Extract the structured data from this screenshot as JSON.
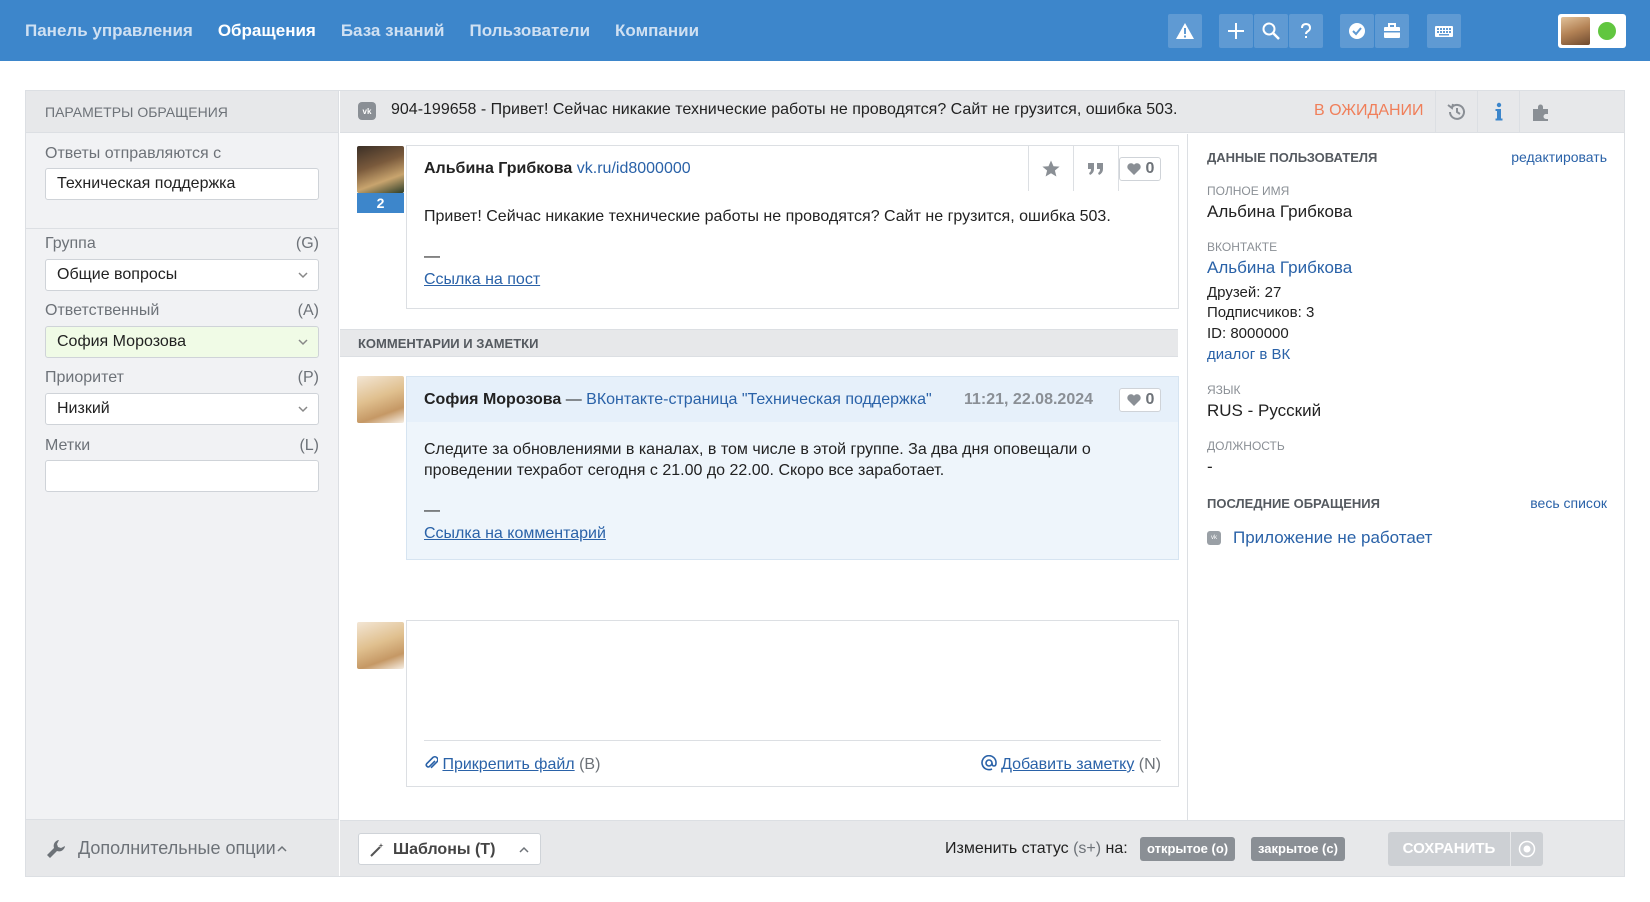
{
  "nav": {
    "items": [
      {
        "label": "Панель управления",
        "active": false
      },
      {
        "label": "Обращения",
        "active": true
      },
      {
        "label": "База знаний",
        "active": false
      },
      {
        "label": "Пользователи",
        "active": false
      },
      {
        "label": "Компании",
        "active": false
      }
    ],
    "toolbar_icons": [
      "warning-icon",
      "plus-icon",
      "search-icon",
      "help-icon",
      "check-badge-icon",
      "briefcase-icon",
      "keyboard-icon"
    ]
  },
  "colors": {
    "accent": "#3d86cb",
    "status_waiting": "#f07f5a",
    "online": "#61c63f",
    "link": "#2a62a8"
  },
  "left": {
    "header": "ПАРАМЕТРЫ ОБРАЩЕНИЯ",
    "reply_from_label": "Ответы отправляются с",
    "reply_from_value": "Техническая поддержка",
    "group_label": "Группа",
    "group_key": "(G)",
    "group_value": "Общие вопросы",
    "assignee_label": "Ответственный",
    "assignee_key": "(A)",
    "assignee_value": "София Морозова",
    "priority_label": "Приоритет",
    "priority_key": "(P)",
    "priority_value": "Низкий",
    "tags_label": "Метки",
    "tags_key": "(L)",
    "tags_value": "",
    "extra_options": "Дополнительные опции"
  },
  "ticket": {
    "channel_icon": "vk-icon",
    "subject": "904-199658 - Привет! Сейчас никакие технические работы не проводятся? Сайт не грузится, ошибка 503.",
    "status": "В ОЖИДАНИИ"
  },
  "message": {
    "author": "Альбина Грибкова",
    "profile_link": "vk.ru/id8000000",
    "count": "2",
    "likes": "0",
    "text": "Привет! Сейчас никакие технические работы не проводятся? Сайт не грузится, ошибка 503.",
    "dash": "—",
    "link": "Ссылка на пост"
  },
  "comments_header": "КОММЕНТАРИИ И ЗАМЕТКИ",
  "comment": {
    "author": "София Морозова",
    "separator": "—",
    "source": "ВКонтакте-страница \"Техническая поддержка\"",
    "time": "11:21, 22.08.2024",
    "likes": "0",
    "text_line1": "Следите за обновлениями в каналах, в том числе в этой группе. За два дня оповещали о",
    "text_line2": "проведении техработ сегодня с 21.00 до 22.00. Скоро все заработает.",
    "dash": "—",
    "link": "Ссылка на комментарий"
  },
  "reply": {
    "attach": "Прикрепить файл",
    "attach_key": "(B)",
    "add_note": "Добавить заметку",
    "add_note_key": "(N)"
  },
  "bottom": {
    "templates": "Шаблоны (T)",
    "change_status_prefix": "Изменить статус",
    "change_status_key": "(s+)",
    "change_status_suffix": "на:",
    "open_btn": "открытое (o)",
    "closed_btn": "закрытое (c)",
    "save": "СОХРАНИТЬ"
  },
  "user": {
    "header": "ДАННЫЕ ПОЛЬЗОВАТЕЛЯ",
    "edit": "редактировать",
    "fullname_label": "ПОЛНОЕ ИМЯ",
    "fullname": "Альбина Грибкова",
    "vk_label": "ВКОНТАКТЕ",
    "vk_name": "Альбина Грибкова",
    "friends": "Друзей: 27",
    "followers": "Подписчиков: 3",
    "id": "ID: 8000000",
    "dialog": "диалог в ВК",
    "lang_label": "ЯЗЫК",
    "lang": "RUS - Русский",
    "position_label": "ДОЛЖНОСТЬ",
    "position": "-",
    "recent_header": "ПОСЛЕДНИЕ ОБРАЩЕНИЯ",
    "recent_all": "весь список",
    "recent_item": "Приложение не работает"
  }
}
